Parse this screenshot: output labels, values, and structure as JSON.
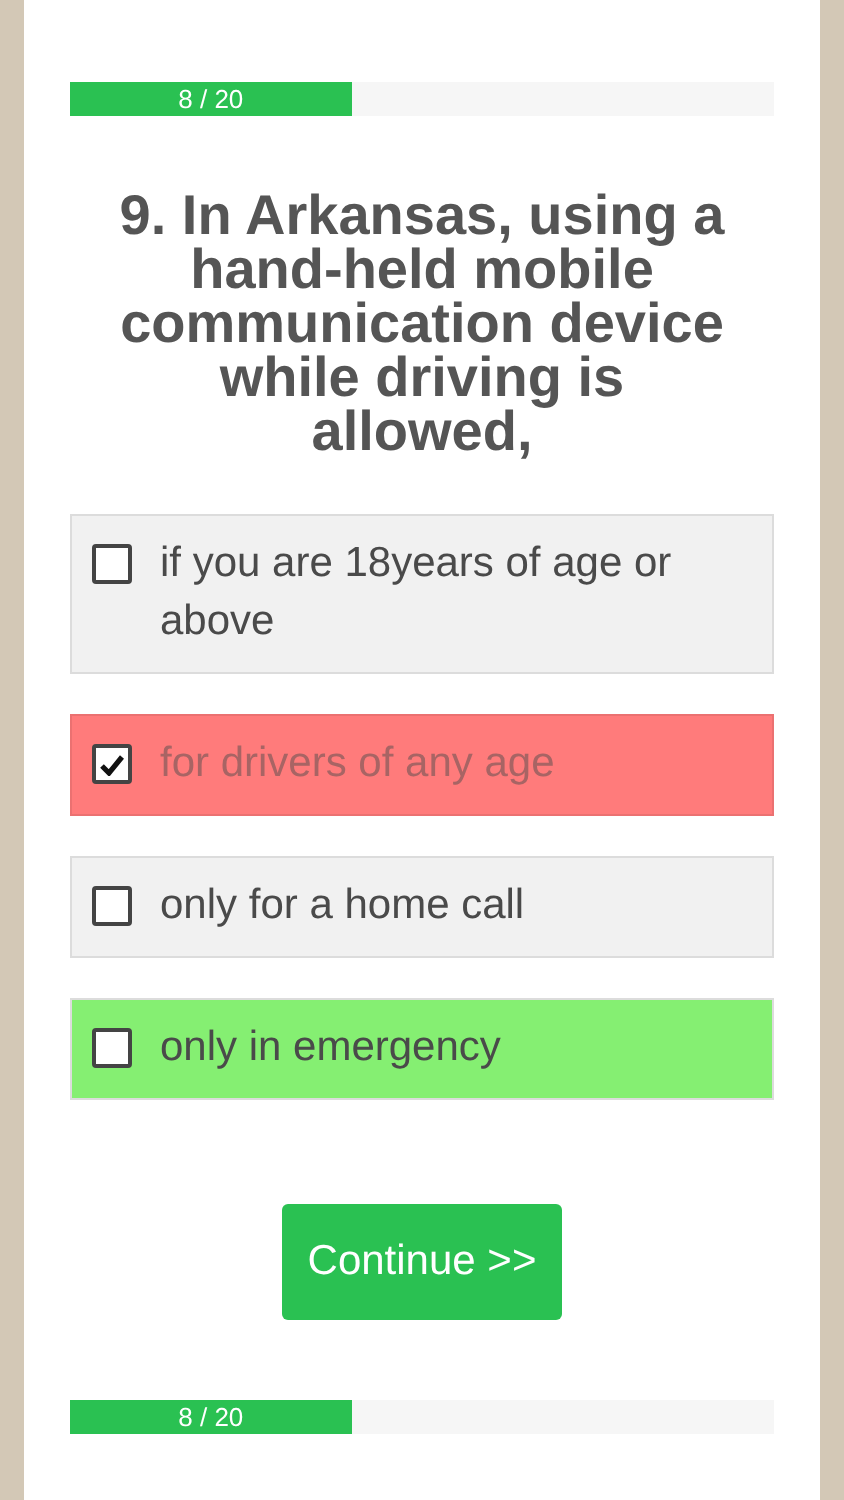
{
  "progress_top": {
    "label": "8 / 20",
    "level": 0.4
  },
  "question": "9. In Arkansas, using a hand-held mobile communication device while driving is allowed,",
  "options": [
    {
      "text": "if you are 18years of age or above",
      "checked": false,
      "color": "#f1f1f1"
    },
    {
      "text": "for drivers of any age",
      "checked": true,
      "color": "#ff7b7b"
    },
    {
      "text": "only for a home call",
      "checked": false,
      "color": "#f1f1f1"
    },
    {
      "text": "only in emergency",
      "checked": false,
      "color": "#85ef72"
    }
  ],
  "continue_button": "Continue >>",
  "progress_bottom": {
    "label": "8 / 20",
    "level": 0.4
  }
}
